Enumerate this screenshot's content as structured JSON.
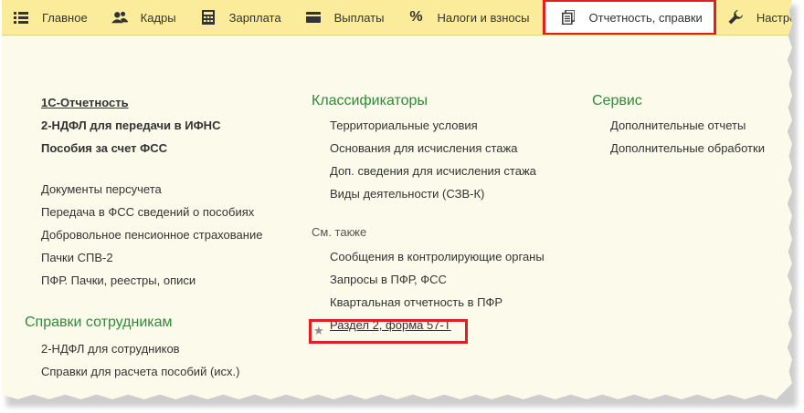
{
  "nav": {
    "items": [
      {
        "label": "Главное",
        "icon": "menu-icon"
      },
      {
        "label": "Кадры",
        "icon": "users-icon"
      },
      {
        "label": "Зарплата",
        "icon": "calculator-icon"
      },
      {
        "label": "Выплаты",
        "icon": "wallet-icon"
      },
      {
        "label": "Налоги и взносы",
        "icon": "percent-icon"
      },
      {
        "label": "Отчетность, справки",
        "icon": "documents-icon",
        "active": true
      },
      {
        "label": "Настро",
        "icon": "wrench-icon"
      }
    ]
  },
  "left": {
    "top_links": [
      "1С-Отчетность",
      "2-НДФЛ для передачи в ИФНС",
      "Пособия за счет ФСС"
    ],
    "links": [
      "Документы персучета",
      "Передача в ФСС сведений о пособиях",
      "Добровольное пенсионное страхование",
      "Пачки СПВ-2",
      "ПФР. Пачки, реестры, описи"
    ],
    "section_title": "Справки сотрудникам",
    "section_links": [
      "2-НДФЛ для сотрудников",
      "Справки для расчета пособий (исх.)"
    ]
  },
  "middle": {
    "section_title": "Классификаторы",
    "links": [
      "Территориальные условия",
      "Основания для исчисления стажа",
      "Доп. сведения для исчисления стажа",
      "Виды деятельности (СЗВ-К)"
    ],
    "see_also_title": "См. также",
    "see_also_links": [
      "Сообщения в контролирующие органы",
      "Запросы в ПФР, ФСС",
      "Квартальная отчетность в ПФР",
      "Раздел 2, форма 57-Т"
    ]
  },
  "right": {
    "section_title": "Сервис",
    "links": [
      "Дополнительные отчеты",
      "Дополнительные обработки"
    ]
  },
  "colors": {
    "navbar": "#fbec9b",
    "accent_green": "#2e8b3a",
    "highlight_red": "#e01f1f",
    "background": "#fbfaeb"
  }
}
